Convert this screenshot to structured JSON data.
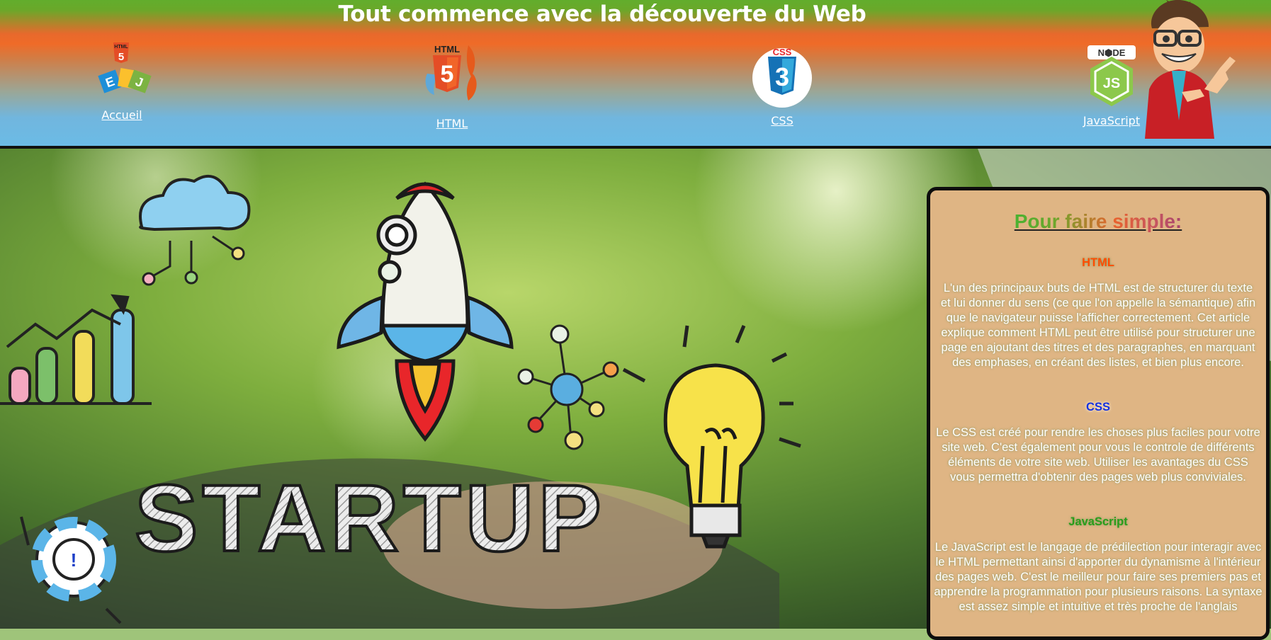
{
  "header": {
    "title": "Tout commence avec la découverte du Web",
    "nav": [
      {
        "label": "Accueil",
        "icon": "html5-logo-icon"
      },
      {
        "label": "HTML",
        "icon": "html5-shield-icon"
      },
      {
        "label": "CSS",
        "icon": "css3-shield-icon"
      },
      {
        "label": "JavaScript",
        "icon": "nodejs-hexagon-icon"
      }
    ]
  },
  "hero": {
    "word": "STARTUP"
  },
  "panel": {
    "title": "Pour faire simple:",
    "sections": [
      {
        "title": "HTML",
        "color": "#ff5500",
        "text": "L'un des principaux buts de HTML est de structurer du texte et lui donner du sens (ce que l'on appelle la sémantique) afin que le navigateur puisse l'afficher correctement. Cet article explique comment HTML peut être utilisé pour structurer une page en ajoutant des titres et des paragraphes, en marquant des emphases, en créant des listes, et bien plus encore."
      },
      {
        "title": "CSS",
        "color": "#1431e0",
        "text": "Le CSS est créé pour rendre les choses plus faciles pour votre site web. C'est également pour vous le controle de différents éléments de votre site web. Utiliser les avantages du CSS vous permettra d'obtenir des pages web plus conviviales."
      },
      {
        "title": "JavaScript",
        "color": "#2a9d1a",
        "text": "Le JavaScript est le langage de prédilection pour interagir avec le HTML permettant ainsi d'apporter du dynamisme à l'intérieur des pages web. C'est le meilleur pour faire ses premiers pas et apprendre la programmation pour plusieurs raisons. La syntaxe est assez simple et intuitive et très proche de l'anglais"
      }
    ]
  }
}
